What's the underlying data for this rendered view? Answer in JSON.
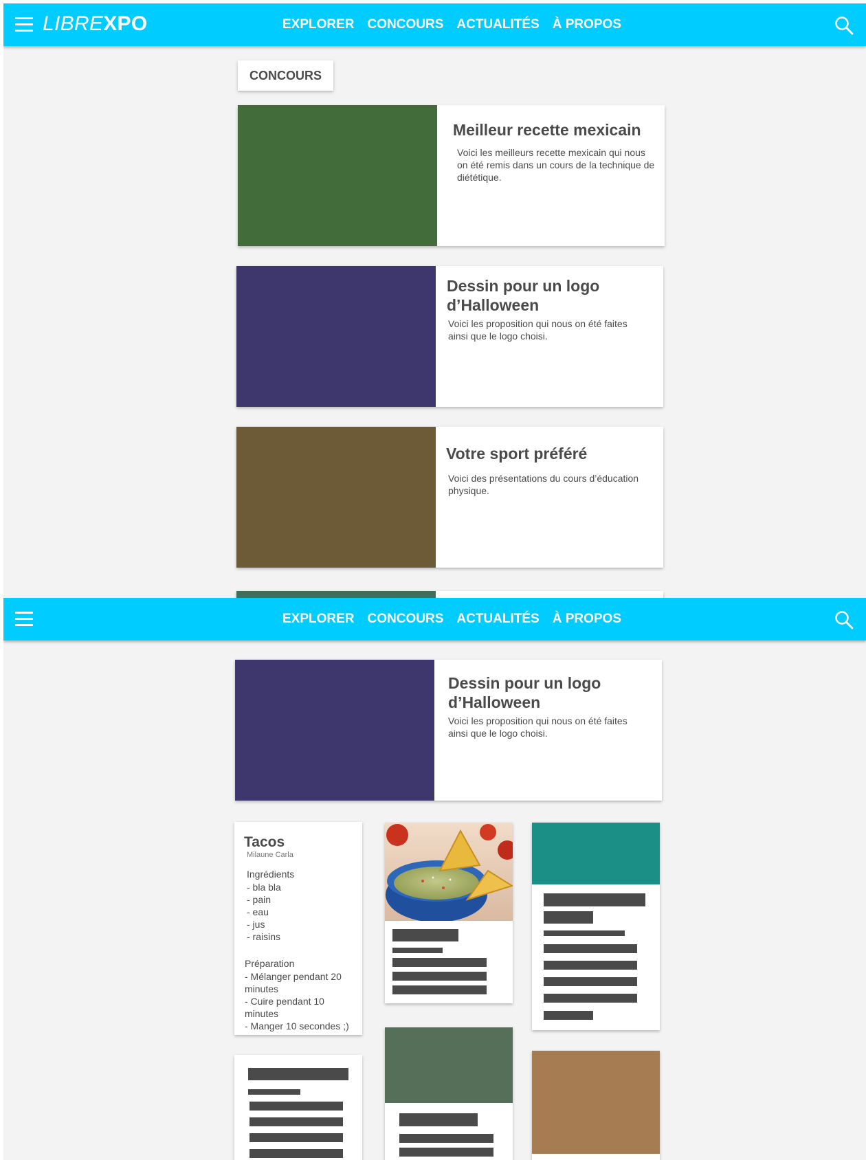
{
  "header": {
    "logo_light": "LIBRE",
    "logo_bold": "XPO",
    "nav": [
      "EXPLORER",
      "CONCOURS",
      "ACTUALITÉS",
      "À PROPOS"
    ],
    "accent_color": "#00ccff",
    "icons": {
      "menu": "hamburger-icon",
      "search": "search-icon"
    }
  },
  "concours": {
    "section_label": "CONCOURS",
    "cards": [
      {
        "title": "Meilleur recette mexicain",
        "description": "Voici les meilleurs recette mexicain qui nous on été remis dans un cours de la technique de diététique.",
        "thumb_color": "#426d3a"
      },
      {
        "title": "Dessin pour un logo d’Halloween",
        "description": "Voici les proposition qui nous on été faites ainsi que le logo choisi.",
        "thumb_color": "#3e376d"
      },
      {
        "title": "Votre sport préféré",
        "description": "Voici des présentations du cours d’éducation physique.",
        "thumb_color": "#6d5b38"
      }
    ],
    "partial_card_color": "#3f6e5a"
  },
  "detail": {
    "contest": {
      "title": "Dessin pour un logo d’Halloween",
      "description": "Voici les proposition qui nous on été faites ainsi que le logo choisi.",
      "thumb_color": "#3e376d"
    },
    "recipe": {
      "title": "Tacos",
      "author": "Milaune Carla",
      "ingredients_heading": "Ingrédients",
      "ingredients": [
        "- bla bla",
        "- pain",
        "- eau",
        "- jus",
        "- raisins"
      ],
      "preparation_heading": "Préparation",
      "preparation": [
        "- Mélanger pendant 20 minutes",
        "- Cuire pendant 10 minutes",
        "- Manger 10 secondes ;)"
      ]
    },
    "tile_colors": {
      "teal": "#1b8e86",
      "green": "#566f59",
      "brown": "#a67c52"
    }
  }
}
